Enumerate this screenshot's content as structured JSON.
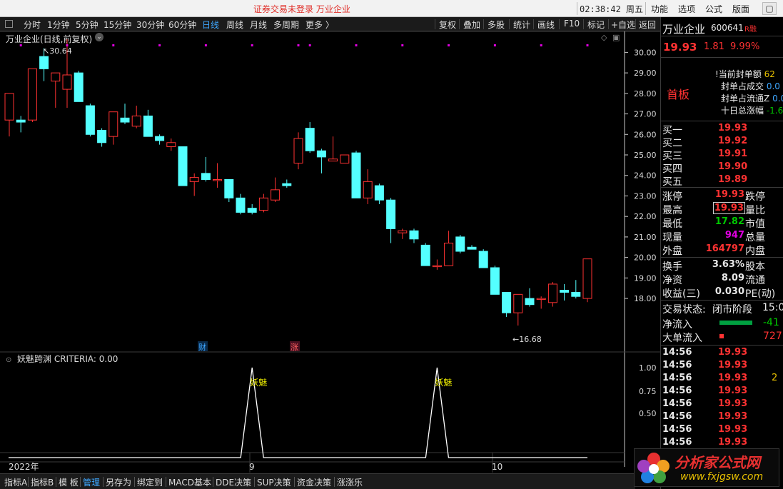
{
  "titlebar": {
    "title": "证券交易未登录  万业企业",
    "clock": "02:38:42 周五",
    "menus": [
      "功能",
      "选项",
      "公式",
      "版面"
    ],
    "close": "▢"
  },
  "toolbar": {
    "periods": [
      "分时",
      "1分钟",
      "5分钟",
      "15分钟",
      "30分钟",
      "60分钟",
      "日线",
      "周线",
      "月线",
      "多周期",
      "更多 〉"
    ],
    "active": "日线",
    "actions": [
      "复权",
      "叠加",
      "多股",
      "统计",
      "画线",
      "F10",
      "标记",
      "+自选",
      "返回"
    ]
  },
  "chart": {
    "header": "万业企业(日线,前复权)",
    "high_label": "30.64",
    "low_label": "16.68",
    "marker_cai": "财",
    "marker_zhang": "涨",
    "y_ticks": [
      "30.00",
      "29.00",
      "28.00",
      "27.00",
      "26.00",
      "25.00",
      "24.00",
      "23.00",
      "22.00",
      "21.00",
      "20.00",
      "19.00",
      "18.00"
    ],
    "x_labels": [
      "2022年",
      "9",
      "10"
    ],
    "colors": {
      "up": "#ff3232",
      "down": "#54ffff",
      "marker_dot": "#e000e0"
    }
  },
  "indicator": {
    "header": "妖魅跨渊  CRITERIA: 0.00",
    "signal_label": "妖魅",
    "y_ticks": [
      "1.00",
      "0.75",
      "0.50"
    ]
  },
  "chart_data": {
    "type": "candlestick",
    "ylim": [
      16.68,
      30.64
    ],
    "candles": [
      {
        "o": 26.7,
        "h": 27.3,
        "l": 25.9,
        "c": 28.0
      },
      {
        "o": 26.7,
        "h": 26.9,
        "l": 26.1,
        "c": 26.6
      },
      {
        "o": 26.7,
        "h": 29.2,
        "l": 26.6,
        "c": 29.2
      },
      {
        "o": 29.8,
        "h": 30.2,
        "l": 28.6,
        "c": 29.2
      },
      {
        "o": 28.6,
        "h": 28.7,
        "l": 27.3,
        "c": 29.0
      },
      {
        "o": 28.2,
        "h": 30.64,
        "l": 27.3,
        "c": 28.9
      },
      {
        "o": 29.0,
        "h": 29.1,
        "l": 27.6,
        "c": 27.6
      },
      {
        "o": 27.4,
        "h": 27.5,
        "l": 25.9,
        "c": 26.0
      },
      {
        "o": 26.2,
        "h": 26.3,
        "l": 25.4,
        "c": 25.6
      },
      {
        "o": 25.9,
        "h": 26.9,
        "l": 25.5,
        "c": 27.1
      },
      {
        "o": 26.8,
        "h": 27.5,
        "l": 26.5,
        "c": 26.6
      },
      {
        "o": 26.4,
        "h": 27.4,
        "l": 26.3,
        "c": 26.9
      },
      {
        "o": 26.9,
        "h": 27.2,
        "l": 25.9,
        "c": 25.9
      },
      {
        "o": 25.9,
        "h": 26.0,
        "l": 25.5,
        "c": 25.7
      },
      {
        "o": 25.4,
        "h": 25.8,
        "l": 25.2,
        "c": 25.6
      },
      {
        "o": 25.4,
        "h": 25.4,
        "l": 23.5,
        "c": 23.5
      },
      {
        "o": 23.7,
        "h": 24.1,
        "l": 23.0,
        "c": 23.9
      },
      {
        "o": 24.1,
        "h": 24.9,
        "l": 23.7,
        "c": 23.8
      },
      {
        "o": 23.8,
        "h": 24.6,
        "l": 23.4,
        "c": 23.8
      },
      {
        "o": 23.8,
        "h": 23.8,
        "l": 22.7,
        "c": 22.9
      },
      {
        "o": 22.9,
        "h": 23.1,
        "l": 22.1,
        "c": 22.2
      },
      {
        "o": 22.4,
        "h": 22.6,
        "l": 22.1,
        "c": 22.2
      },
      {
        "o": 22.3,
        "h": 23.1,
        "l": 22.2,
        "c": 22.9
      },
      {
        "o": 22.8,
        "h": 23.9,
        "l": 22.7,
        "c": 23.3
      },
      {
        "o": 23.6,
        "h": 23.8,
        "l": 23.4,
        "c": 23.5
      },
      {
        "o": 24.6,
        "h": 26.1,
        "l": 24.3,
        "c": 25.8
      },
      {
        "o": 26.3,
        "h": 26.6,
        "l": 25.1,
        "c": 25.2
      },
      {
        "o": 25.2,
        "h": 25.3,
        "l": 24.1,
        "c": 24.9
      },
      {
        "o": 24.7,
        "h": 25.9,
        "l": 24.7,
        "c": 24.8
      },
      {
        "o": 24.6,
        "h": 25.0,
        "l": 24.6,
        "c": 25.0
      },
      {
        "o": 25.1,
        "h": 25.2,
        "l": 22.9,
        "c": 22.9
      },
      {
        "o": 22.9,
        "h": 24.3,
        "l": 22.6,
        "c": 23.7
      },
      {
        "o": 23.5,
        "h": 23.6,
        "l": 22.6,
        "c": 22.8
      },
      {
        "o": 22.8,
        "h": 22.9,
        "l": 20.7,
        "c": 21.4
      },
      {
        "o": 21.2,
        "h": 21.4,
        "l": 20.9,
        "c": 21.3
      },
      {
        "o": 21.3,
        "h": 21.4,
        "l": 20.7,
        "c": 20.9
      },
      {
        "o": 20.6,
        "h": 20.7,
        "l": 19.6,
        "c": 19.6
      },
      {
        "o": 19.6,
        "h": 19.9,
        "l": 19.4,
        "c": 19.6
      },
      {
        "o": 19.6,
        "h": 21.3,
        "l": 19.6,
        "c": 20.7
      },
      {
        "o": 21.0,
        "h": 21.1,
        "l": 20.2,
        "c": 20.3
      },
      {
        "o": 20.5,
        "h": 20.6,
        "l": 20.4,
        "c": 20.4
      },
      {
        "o": 20.3,
        "h": 20.4,
        "l": 19.5,
        "c": 19.5
      },
      {
        "o": 19.5,
        "h": 19.6,
        "l": 18.2,
        "c": 18.2
      },
      {
        "o": 18.3,
        "h": 18.3,
        "l": 17.1,
        "c": 17.3
      },
      {
        "o": 17.3,
        "h": 18.2,
        "l": 16.68,
        "c": 18.2
      },
      {
        "o": 18.0,
        "h": 18.5,
        "l": 17.6,
        "c": 17.7
      },
      {
        "o": 18.0,
        "h": 18.1,
        "l": 17.5,
        "c": 18.0
      },
      {
        "o": 17.8,
        "h": 18.8,
        "l": 17.6,
        "c": 18.7
      },
      {
        "o": 18.4,
        "h": 18.7,
        "l": 17.9,
        "c": 18.3
      },
      {
        "o": 18.3,
        "h": 18.9,
        "l": 18.0,
        "c": 18.1
      },
      {
        "o": 18.0,
        "h": 19.93,
        "l": 17.82,
        "c": 19.93
      }
    ],
    "signal_index": [
      21,
      37
    ],
    "signal_ylim": [
      0,
      1
    ]
  },
  "quote": {
    "name": "万业企业",
    "code": "600641",
    "badge": "R",
    "badge2": "融",
    "price": "19.93",
    "change": "1.81",
    "pct": "9.99%",
    "status_big": "首板",
    "seal_rows": [
      {
        "label": "!当前封单额",
        "value": "62"
      },
      {
        "label": "封单占成交",
        "value": "0.0"
      },
      {
        "label": "封单占流通Z",
        "value": "0.0"
      },
      {
        "label": "十日总涨幅",
        "value": "-1.6"
      }
    ],
    "bids": [
      {
        "label": "买一",
        "price": "19.93"
      },
      {
        "label": "买二",
        "price": "19.92"
      },
      {
        "label": "买三",
        "price": "19.91"
      },
      {
        "label": "买四",
        "price": "19.90"
      },
      {
        "label": "买五",
        "price": "19.89"
      }
    ],
    "stats": [
      {
        "l": "涨停",
        "v": "19.93",
        "r": "跌停"
      },
      {
        "l": "最高",
        "v": "19.93",
        "r": "量比"
      },
      {
        "l": "最低",
        "v": "17.82",
        "r": "市值"
      },
      {
        "l": "现量",
        "v": "947",
        "r": "总量"
      },
      {
        "l": "外盘",
        "v": "164797",
        "r": "内盘"
      }
    ],
    "fund": [
      {
        "l": "换手",
        "v": "3.63%",
        "r": "股本"
      },
      {
        "l": "净资",
        "v": "8.09",
        "r": "流通"
      },
      {
        "l": "收益(三)",
        "v": "0.030",
        "r": "PE(动)"
      }
    ],
    "trade_state_label": "交易状态:",
    "trade_state": "闭市阶段",
    "trade_time": "15:0",
    "net_in_label": "净流入",
    "net_in": "-41",
    "big_in_label": "大单流入",
    "big_in": "727",
    "ticks": [
      {
        "t": "14:56",
        "p": "19.93",
        "v": ""
      },
      {
        "t": "14:56",
        "p": "19.93",
        "v": ""
      },
      {
        "t": "14:56",
        "p": "19.93",
        "v": "2"
      },
      {
        "t": "14:56",
        "p": "19.93",
        "v": ""
      },
      {
        "t": "14:56",
        "p": "19.93",
        "v": ""
      },
      {
        "t": "14:56",
        "p": "19.93",
        "v": ""
      },
      {
        "t": "14:56",
        "p": "19.93",
        "v": ""
      },
      {
        "t": "14:56",
        "p": "19.93",
        "v": ""
      }
    ]
  },
  "bottom_tabs": [
    "指标A",
    "指标B",
    "模 板",
    "管理",
    "另存为",
    "绑定到",
    "MACD基本",
    "DDE决策",
    "SUP决策",
    "资金决策",
    "涨涨乐"
  ],
  "bottom_active": "管理",
  "watermark": {
    "title": "分析家公式网",
    "url": "www.fxjgsw.com"
  }
}
